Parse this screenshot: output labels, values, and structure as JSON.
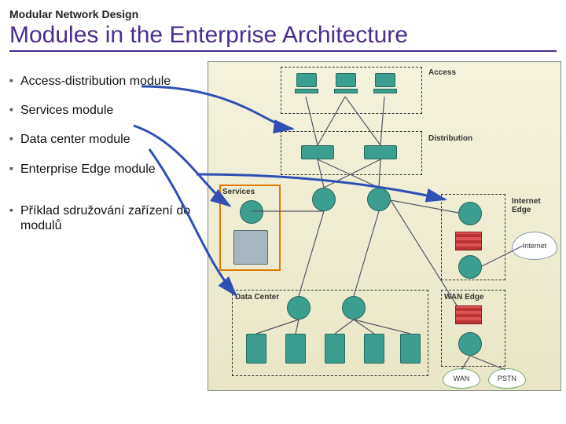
{
  "header": {
    "kicker": "Modular Network Design",
    "title": "Modules in the Enterprise Architecture"
  },
  "bullets": [
    "Access-distribution module",
    "Services module",
    "Data center module",
    "Enterprise Edge module",
    "Příklad sdružování zařízení do modulů"
  ],
  "labels": {
    "access": "Access",
    "distribution": "Distribution",
    "services": "Services",
    "datacenter": "Data Center",
    "internet_edge": "Internet Edge",
    "wan_edge": "WAN Edge",
    "internet": "Internet",
    "wan": "WAN",
    "pstn": "PSTN"
  },
  "colors": {
    "title_purple": "#4a2d8f",
    "device_teal": "#3b9e8f",
    "module_orange": "#e07b00",
    "firewall_red": "#b33"
  }
}
